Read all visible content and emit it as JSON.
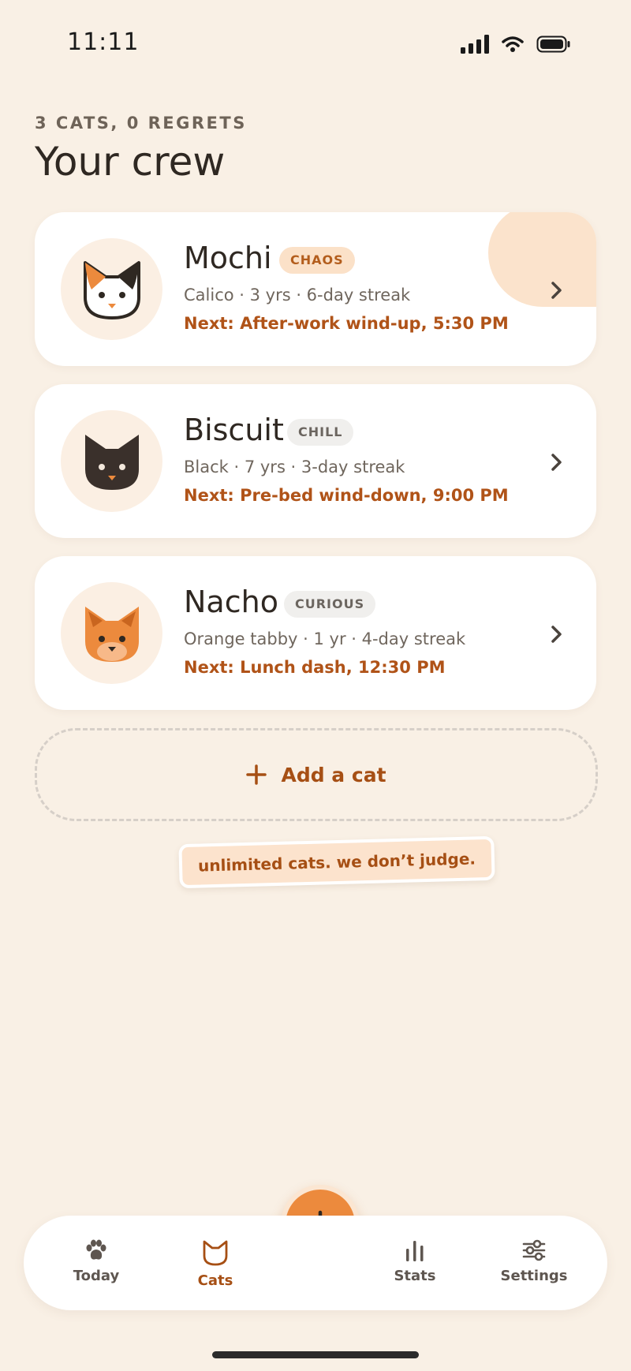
{
  "status_bar": {
    "time": "11:11"
  },
  "header": {
    "eyebrow": "3 CATS, 0 REGRETS",
    "title": "Your crew"
  },
  "cats": [
    {
      "name": "Mochi",
      "badge": "CHAOS",
      "meta": "Calico · 3 yrs · 6-day streak",
      "next": "Next: After-work wind-up, 5:30 PM",
      "avatar_icon": "calico-cat-icon"
    },
    {
      "name": "Biscuit",
      "badge": "CHILL",
      "meta": "Black · 7 yrs · 3-day streak",
      "next": "Next: Pre-bed wind-down, 9:00 PM",
      "avatar_icon": "black-cat-icon"
    },
    {
      "name": "Nacho",
      "badge": "CURIOUS",
      "meta": "Orange tabby · 1 yr · 4-day streak",
      "next": "Next: Lunch dash, 12:30 PM",
      "avatar_icon": "orange-cat-icon"
    }
  ],
  "add_cat": {
    "label": "Add a cat"
  },
  "sticker": {
    "text": "unlimited cats. we don’t judge."
  },
  "tabs": [
    {
      "label": "Today",
      "icon": "paw-icon"
    },
    {
      "label": "Cats",
      "icon": "cat-icon",
      "active": true
    },
    {
      "label": "Stats",
      "icon": "bar-chart-icon"
    },
    {
      "label": "Settings",
      "icon": "sliders-icon"
    }
  ],
  "colors": {
    "accent": "#ec8a3d",
    "accent_text": "#b05318",
    "background": "#f9f0e5"
  }
}
